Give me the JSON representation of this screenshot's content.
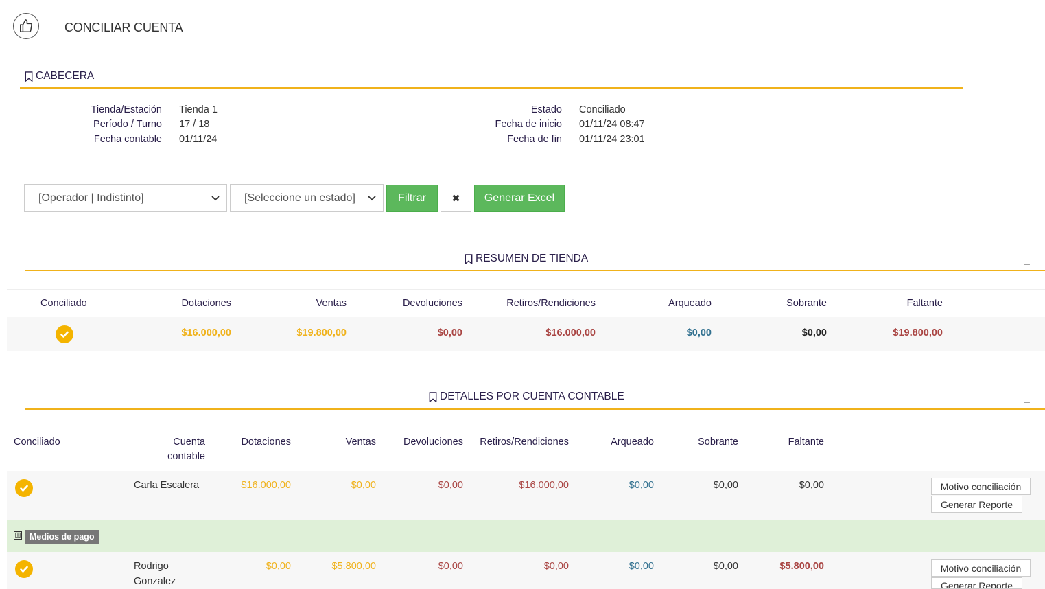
{
  "page": {
    "title": "CONCILIAR CUENTA",
    "logo_icon": "thumbs-up-icon"
  },
  "cabecera": {
    "title": "CABECERA",
    "collapse": "_",
    "left": [
      {
        "label": "Tienda/Estación",
        "value": "Tienda 1"
      },
      {
        "label": "Período / Turno",
        "value": "17 / 18"
      },
      {
        "label": "Fecha contable",
        "value": "01/11/24"
      }
    ],
    "right": [
      {
        "label": "Estado",
        "value": "Conciliado"
      },
      {
        "label": "Fecha de inicio",
        "value": "01/11/24 08:47"
      },
      {
        "label": "Fecha de fin",
        "value": "01/11/24 23:01"
      }
    ]
  },
  "filters": {
    "operador": "[Operador | Indistinto]",
    "estado": "[Seleccione un estado]",
    "filtrar": "Filtrar",
    "clear": "✖",
    "excel": "Generar Excel"
  },
  "resumen": {
    "title": "RESUMEN DE TIENDA",
    "collapse": "_",
    "headers": [
      "Conciliado",
      "Dotaciones",
      "Ventas",
      "Devoluciones",
      "Retiros/Rendiciones",
      "Arqueado",
      "Sobrante",
      "Faltante"
    ],
    "row": {
      "dotaciones": "$16.000,00",
      "ventas": "$19.800,00",
      "devoluciones": "$0,00",
      "retiros": "$16.000,00",
      "arqueado": "$0,00",
      "sobrante": "$0,00",
      "faltante": "$19.800,00"
    }
  },
  "detalles": {
    "title": "DETALLES POR CUENTA CONTABLE",
    "collapse": "_",
    "headers": {
      "conciliado": "Conciliado",
      "cuenta_line1": "Cuenta",
      "cuenta_line2": "contable",
      "dotaciones": "Dotaciones",
      "ventas": "Ventas",
      "devoluciones": "Devoluciones",
      "retiros": "Retiros/Rendiciones",
      "arqueado": "Arqueado",
      "sobrante": "Sobrante",
      "faltante": "Faltante"
    },
    "rows": [
      {
        "cuenta_line1": "Carla Escalera",
        "cuenta_line2": "",
        "dotaciones": "$16.000,00",
        "ventas": "$0,00",
        "devoluciones": "$0,00",
        "retiros": "$16.000,00",
        "arqueado": "$0,00",
        "sobrante": "$0,00",
        "faltante": "$0,00",
        "motivo": "Motivo conciliación",
        "reporte": "Generar Reporte"
      },
      {
        "cuenta_line1": "Rodrigo",
        "cuenta_line2": "Gonzalez",
        "dotaciones": "$0,00",
        "ventas": "$5.800,00",
        "devoluciones": "$0,00",
        "retiros": "$0,00",
        "arqueado": "$0,00",
        "sobrante": "$0,00",
        "faltante": "$5.800,00",
        "motivo": "Motivo conciliación",
        "reporte": "Generar Reporte"
      }
    ],
    "medios": {
      "expand": "⊞",
      "label": "Medios de pago"
    }
  },
  "colors": {
    "accent": "#f0b21b",
    "green": "#5cb85c",
    "red": "#a94442",
    "blue": "#31708f",
    "heading": "#2a1f4a"
  }
}
